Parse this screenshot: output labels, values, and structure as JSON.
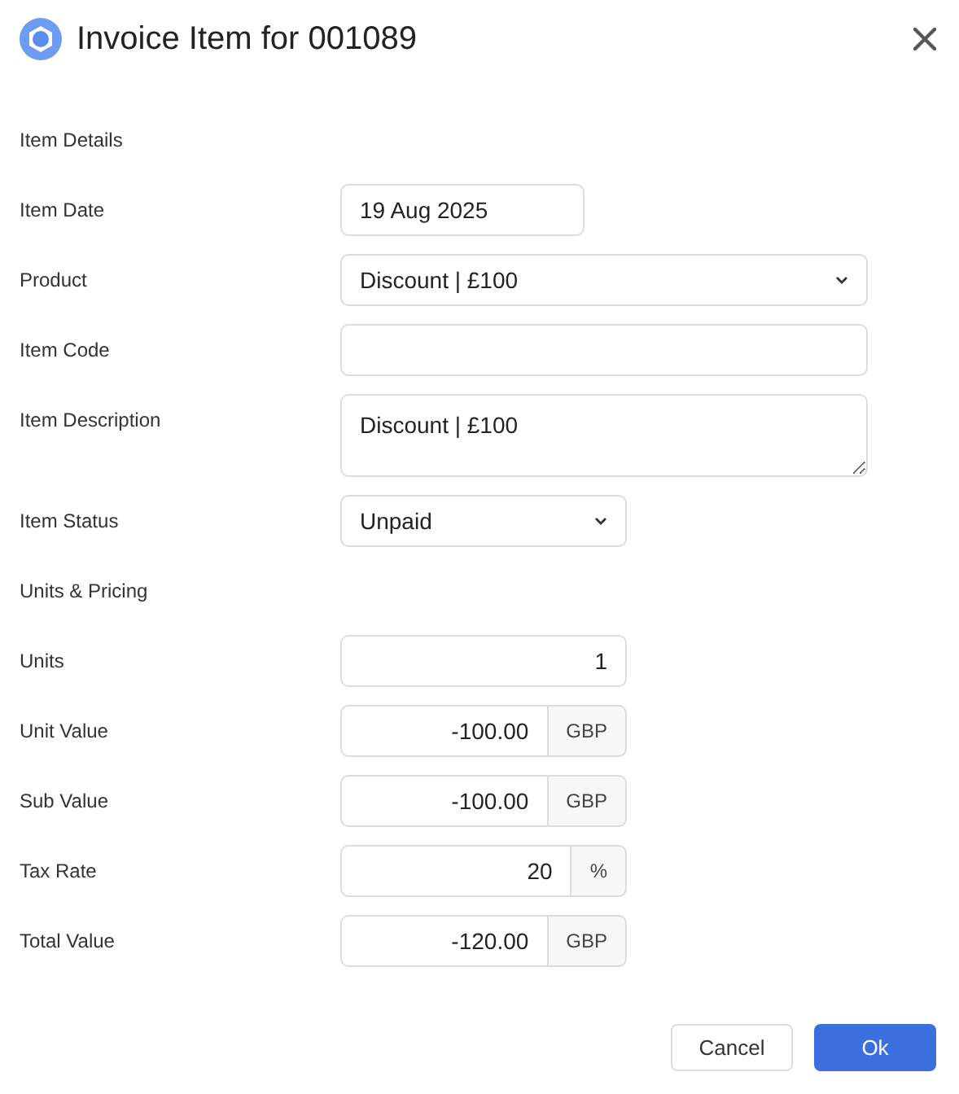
{
  "dialog": {
    "title": "Invoice Item for 001089"
  },
  "rows": [
    {
      "kind": "heading",
      "label": "Item Details"
    },
    {
      "kind": "date",
      "label": "Item Date",
      "value": "19 Aug 2025"
    },
    {
      "kind": "select",
      "label": "Product",
      "value": "Discount | £100"
    },
    {
      "kind": "text",
      "label": "Item Code"
    },
    {
      "kind": "textarea",
      "label": "Item Description",
      "value": "Discount | £100"
    },
    {
      "kind": "select-short",
      "label": "Item Status",
      "value": "Unpaid"
    },
    {
      "kind": "heading",
      "label": "Units & Pricing"
    },
    {
      "kind": "number",
      "label": "Units",
      "value": "1"
    },
    {
      "kind": "number",
      "label": "Unit Value",
      "value": "-100.00",
      "addon": "GBP"
    },
    {
      "kind": "number",
      "label": "Sub Value",
      "value": "-100.00",
      "addon": "GBP"
    },
    {
      "kind": "number",
      "label": "Tax Rate",
      "value": "20",
      "addon": "%"
    },
    {
      "kind": "number",
      "label": "Total Value",
      "value": "-120.00",
      "addon": "GBP"
    }
  ],
  "buttons": [
    {
      "label": "Cancel",
      "kind": "secondary"
    },
    {
      "label": "Ok",
      "kind": "primary"
    }
  ]
}
